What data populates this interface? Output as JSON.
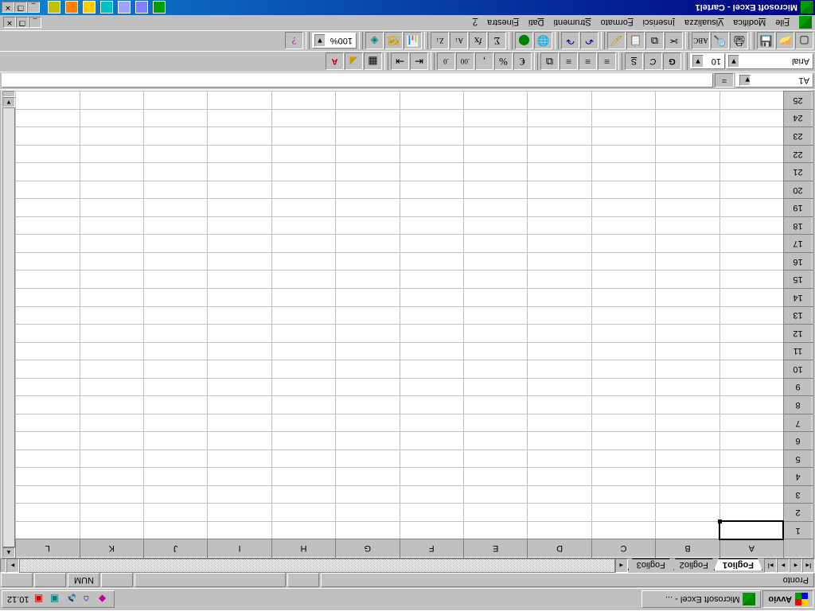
{
  "taskbar": {
    "start": "Avvio",
    "app": "Microsoft Excel - ...",
    "time": "10.12"
  },
  "status": {
    "ready": "Pronto",
    "numlock": "NUM"
  },
  "tabs": {
    "sheets": [
      "Foglio1",
      "Foglio2",
      "Foglio3"
    ],
    "active": 0
  },
  "grid": {
    "columns": [
      "A",
      "B",
      "C",
      "D",
      "E",
      "F",
      "G",
      "H",
      "I",
      "J",
      "K",
      "L"
    ],
    "rows": [
      1,
      2,
      3,
      4,
      5,
      6,
      7,
      8,
      9,
      10,
      11,
      12,
      13,
      14,
      15,
      16,
      17,
      18,
      19,
      20,
      21,
      22,
      23,
      24,
      25
    ],
    "active_cell": "A1"
  },
  "formula": {
    "name_box": "A1",
    "equals": "=",
    "value": ""
  },
  "format_toolbar": {
    "font": "Arial",
    "size": "10",
    "bold": "G",
    "italic": "C",
    "underline": "S",
    "zoom": "100%"
  },
  "menus": [
    "File",
    "Modifica",
    "Visualizza",
    "Inserisci",
    "Formato",
    "Strumenti",
    "Dati",
    "Finestra",
    "?"
  ],
  "title": "Microsoft Excel - Cartel1"
}
